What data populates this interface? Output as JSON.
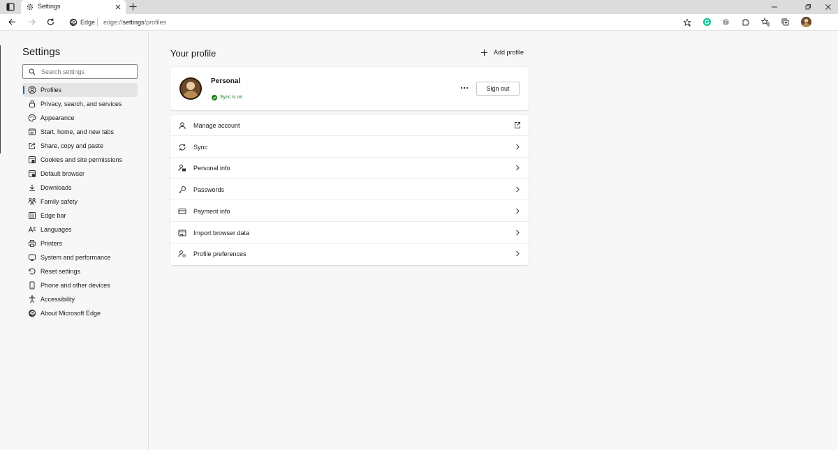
{
  "tab": {
    "title": "Settings"
  },
  "address": {
    "brand": "Edge",
    "url_prefix": "edge://",
    "url_em": "settings",
    "url_rest": "/profiles"
  },
  "sidebar": {
    "title": "Settings",
    "search_placeholder": "Search settings",
    "items": [
      {
        "label": "Profiles",
        "icon": "profiles-icon",
        "active": true
      },
      {
        "label": "Privacy, search, and services",
        "icon": "lock-icon"
      },
      {
        "label": "Appearance",
        "icon": "palette-icon"
      },
      {
        "label": "Start, home, and new tabs",
        "icon": "home-tabs-icon"
      },
      {
        "label": "Share, copy and paste",
        "icon": "share-icon"
      },
      {
        "label": "Cookies and site permissions",
        "icon": "cookies-icon"
      },
      {
        "label": "Default browser",
        "icon": "default-browser-icon"
      },
      {
        "label": "Downloads",
        "icon": "download-icon"
      },
      {
        "label": "Family safety",
        "icon": "family-icon"
      },
      {
        "label": "Edge bar",
        "icon": "edge-bar-icon"
      },
      {
        "label": "Languages",
        "icon": "languages-icon"
      },
      {
        "label": "Printers",
        "icon": "printer-icon"
      },
      {
        "label": "System and performance",
        "icon": "system-icon"
      },
      {
        "label": "Reset settings",
        "icon": "reset-icon"
      },
      {
        "label": "Phone and other devices",
        "icon": "phone-icon"
      },
      {
        "label": "Accessibility",
        "icon": "accessibility-icon"
      },
      {
        "label": "About Microsoft Edge",
        "icon": "edge-logo-icon"
      }
    ]
  },
  "main": {
    "title": "Your profile",
    "add_profile_label": "Add profile",
    "profile": {
      "name": "Personal",
      "sync_status": "Sync is on",
      "sign_out_label": "Sign out"
    },
    "options": [
      {
        "label": "Manage account",
        "icon": "person-icon",
        "trailing": "external-link-icon"
      },
      {
        "label": "Sync",
        "icon": "sync-icon",
        "trailing": "chevron-right-icon"
      },
      {
        "label": "Personal info",
        "icon": "personal-info-icon",
        "trailing": "chevron-right-icon"
      },
      {
        "label": "Passwords",
        "icon": "key-icon",
        "trailing": "chevron-right-icon"
      },
      {
        "label": "Payment info",
        "icon": "card-icon",
        "trailing": "chevron-right-icon"
      },
      {
        "label": "Import browser data",
        "icon": "import-icon",
        "trailing": "chevron-right-icon"
      },
      {
        "label": "Profile preferences",
        "icon": "profile-prefs-icon",
        "trailing": "chevron-right-icon"
      }
    ]
  },
  "colors": {
    "accent": "#0f6cbd",
    "sync_green": "#1e7a1e",
    "tab_strip": "#dcdcdc",
    "page_bg": "#f7f7f7"
  }
}
